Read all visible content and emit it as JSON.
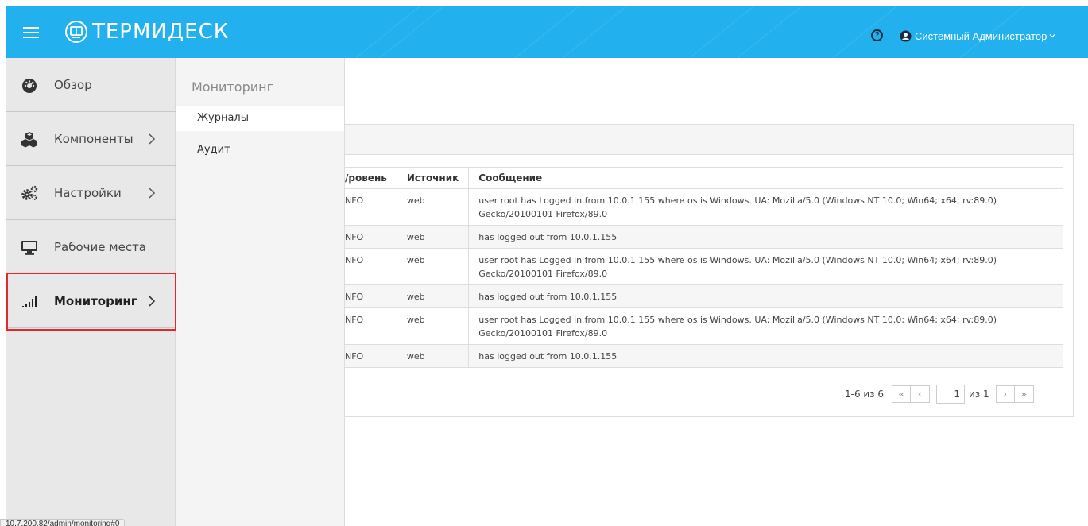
{
  "header": {
    "menu_icon": "hamburger-icon",
    "brand": "ТЕРМИДЕСК",
    "logo_icon": "termidesk-logo-icon",
    "help_icon": "question-circle-icon",
    "user_icon": "user-circle-icon",
    "user_name": "Системный Администратор",
    "background_color": "#22b0ef"
  },
  "sidebar": {
    "items": [
      {
        "label": "Обзор",
        "icon": "dashboard-icon",
        "has_arrow": false
      },
      {
        "label": "Компоненты",
        "icon": "cubes-icon",
        "has_arrow": true
      },
      {
        "label": "Настройки",
        "icon": "gears-icon",
        "has_arrow": true
      },
      {
        "label": "Рабочие места",
        "icon": "desktop-icon",
        "has_arrow": false
      },
      {
        "label": "Мониторинг",
        "icon": "signal-bars-icon",
        "has_arrow": true,
        "active": true
      }
    ],
    "highlight_color": "#e2282d"
  },
  "submenu": {
    "title": "Мониторинг",
    "items": [
      {
        "label": "Журналы",
        "selected": true
      },
      {
        "label": "Аудит",
        "selected": false
      }
    ]
  },
  "logs": {
    "columns": [
      "Уровень",
      "Источник",
      "Сообщение"
    ],
    "column_visible": [
      "/ровень",
      "Источник",
      "Сообщение"
    ],
    "rows": [
      {
        "level": "NFO",
        "source": "web",
        "message": "user root has Logged in from 10.0.1.155 where os is Windows. UA: Mozilla/5.0 (Windows NT 10.0; Win64; x64; rv:89.0) Gecko/20100101 Firefox/89.0"
      },
      {
        "level": "NFO",
        "source": "web",
        "message": "has logged out from 10.0.1.155"
      },
      {
        "level": "NFO",
        "source": "web",
        "message": "user root has Logged in from 10.0.1.155 where os is Windows. UA: Mozilla/5.0 (Windows NT 10.0; Win64; x64; rv:89.0) Gecko/20100101 Firefox/89.0"
      },
      {
        "level": "NFO",
        "source": "web",
        "message": "has logged out from 10.0.1.155"
      },
      {
        "level": "NFO",
        "source": "web",
        "message": "user root has Logged in from 10.0.1.155 where os is Windows. UA: Mozilla/5.0 (Windows NT 10.0; Win64; x64; rv:89.0) Gecko/20100101 Firefox/89.0"
      },
      {
        "level": "NFO",
        "source": "web",
        "message": "has logged out from 10.0.1.155"
      }
    ]
  },
  "pagination": {
    "range": "1-6 из 6",
    "page_value": "1",
    "of_total": "из 1",
    "first_icon": "«",
    "prev_icon": "‹",
    "next_icon": "›",
    "last_icon": "»"
  },
  "status_url": "10.7.200.82/admin/monitoring#0"
}
